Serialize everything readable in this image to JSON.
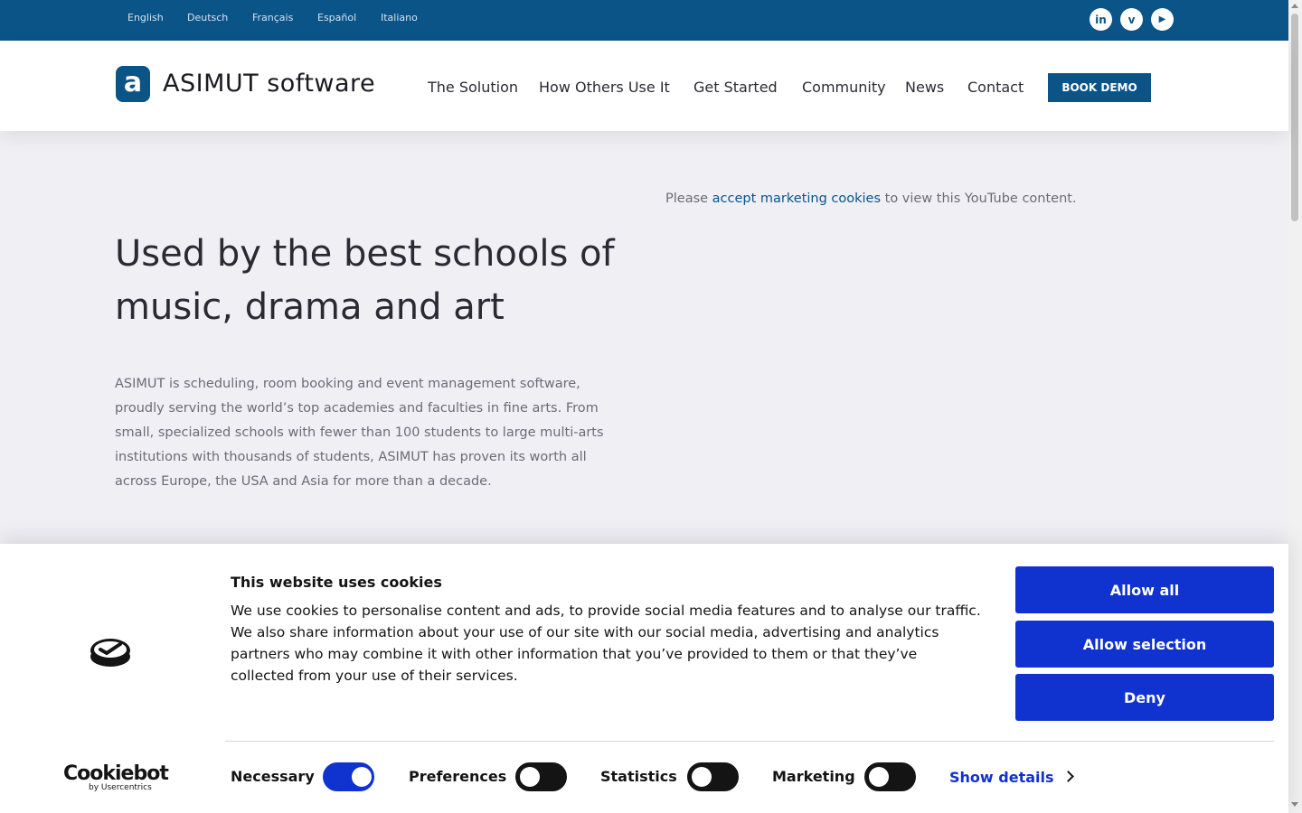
{
  "topbar": {
    "languages": [
      "English",
      "Deutsch",
      "Français",
      "Español",
      "Italiano"
    ],
    "social": [
      {
        "name": "linkedin-icon",
        "glyph": "in"
      },
      {
        "name": "vimeo-icon",
        "glyph": "v"
      },
      {
        "name": "youtube-icon",
        "glyph": "▶"
      }
    ]
  },
  "header": {
    "logo_letter": "a",
    "logo_text": "ASIMUT software",
    "nav": [
      "The Solution",
      "How Others Use It",
      "Get Started",
      "Community",
      "News",
      "Contact"
    ],
    "cta": "BOOK DEMO"
  },
  "hero": {
    "title": "Used by the best schools of music, drama and art",
    "body": "ASIMUT is scheduling, room booking and event management software, proudly serving the world’s top academies and faculties in fine arts. From small, specialized schools with fewer than 100 students to large multi-arts institutions with thousands of students, ASIMUT has proven its worth all across Europe, the USA and Asia for more than a decade.",
    "yt_prefix": "Please ",
    "yt_link": "accept marketing cookies",
    "yt_suffix": " to view this YouTube content."
  },
  "cookie": {
    "title": "This website uses cookies",
    "text": "We use cookies to personalise content and ads, to provide social media features and to analyse our traffic. We also share information about your use of our site with our social media, advertising and analytics partners who may combine it with other information that you’ve provided to them or that they’ve collected from your use of their services.",
    "buttons": {
      "allow_all": "Allow all",
      "allow_selection": "Allow selection",
      "deny": "Deny"
    },
    "brand": "Cookiebot",
    "brand_sub": "by Usercentrics",
    "toggles": [
      {
        "label": "Necessary",
        "on": true
      },
      {
        "label": "Preferences",
        "on": false
      },
      {
        "label": "Statistics",
        "on": false
      },
      {
        "label": "Marketing",
        "on": false
      }
    ],
    "show_details": "Show details"
  },
  "colors": {
    "brand": "#0b5488",
    "cookie_accent": "#1032cf"
  }
}
